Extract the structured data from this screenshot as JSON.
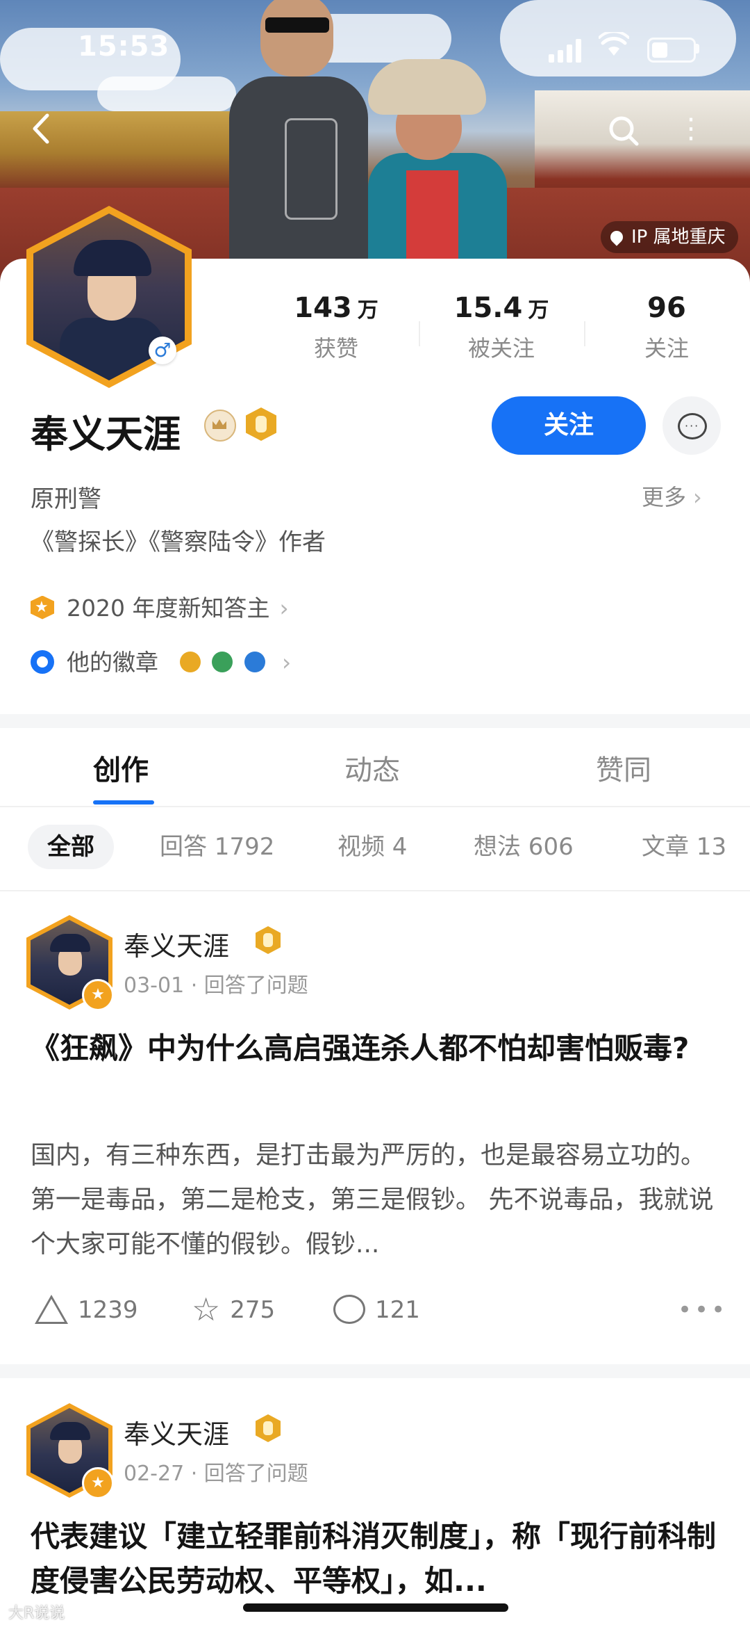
{
  "status_bar": {
    "time": "15:53"
  },
  "cover": {
    "ip_location": "IP 属地重庆"
  },
  "profile": {
    "name": "奉义天涯",
    "gender_symbol": "♂",
    "stats": [
      {
        "value": "143",
        "unit": "万",
        "label": "获赞"
      },
      {
        "value": "15.4",
        "unit": "万",
        "label": "被关注"
      },
      {
        "value": "96",
        "unit": "",
        "label": "关注"
      }
    ],
    "follow_label": "关注",
    "bio_line1": "原刑警",
    "bio_line2": "《警探长》《警察陆令》作者",
    "more_label": "更多",
    "honor_label": "2020 年度新知答主",
    "badges_label": "他的徽章",
    "badge_colors": [
      "#e9a924",
      "#3aa05a",
      "#2b7bd8"
    ]
  },
  "tabs": [
    {
      "label": "创作",
      "active": true
    },
    {
      "label": "动态",
      "active": false
    },
    {
      "label": "赞同",
      "active": false
    }
  ],
  "filters": [
    {
      "label": "全部",
      "active": true
    },
    {
      "label": "回答 1792",
      "active": false
    },
    {
      "label": "视频 4",
      "active": false
    },
    {
      "label": "想法 606",
      "active": false
    },
    {
      "label": "文章 13",
      "active": false
    }
  ],
  "feed": [
    {
      "author": "奉义天涯",
      "meta": "03-01 · 回答了问题",
      "title": "《狂飙》中为什么高启强连杀人都不怕却害怕贩毒?",
      "excerpt": "国内，有三种东西，是打击最为严厉的，也是最容易立功的。 第一是毒品，第二是枪支，第三是假钞。 先不说毒品，我就说个大家可能不懂的假钞。假钞...",
      "upvotes": "1239",
      "favorites": "275",
      "comments": "121"
    },
    {
      "author": "奉义天涯",
      "meta": "02-27 · 回答了问题",
      "title": "代表建议「建立轻罪前科消灭制度」，称「现行前科制度侵害公民劳动权、平等权」，如..."
    }
  ],
  "watermark": "大R说说"
}
